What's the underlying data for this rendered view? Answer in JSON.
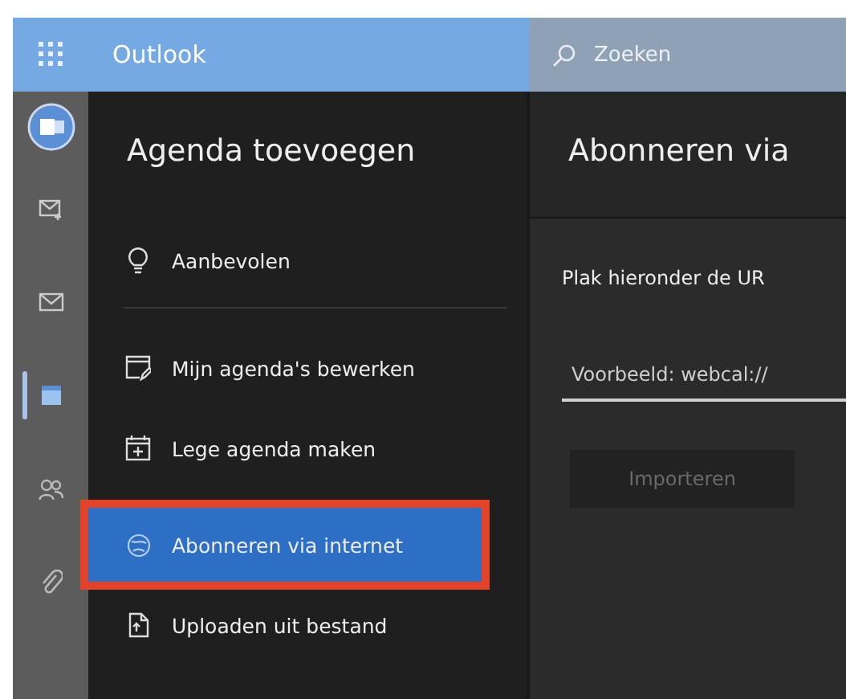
{
  "topbar": {
    "app_name": "Outlook",
    "search": {
      "placeholder": "Zoeken"
    }
  },
  "rail": [
    {
      "kind": "app",
      "selected": false
    },
    {
      "kind": "compose",
      "selected": false
    },
    {
      "kind": "mail",
      "selected": false
    },
    {
      "kind": "calendar",
      "selected": true
    },
    {
      "kind": "people",
      "selected": false
    },
    {
      "kind": "attach",
      "selected": false
    }
  ],
  "menu": {
    "title": "Agenda toevoegen",
    "items": [
      {
        "kind": "bulb",
        "label": "Aanbevolen",
        "selected": false,
        "highlighted": false,
        "divider_after": true
      },
      {
        "kind": "edit",
        "label": "Mijn agenda's bewerken",
        "selected": false,
        "highlighted": false,
        "divider_after": false
      },
      {
        "kind": "new",
        "label": "Lege agenda maken",
        "selected": false,
        "highlighted": false,
        "divider_after": false
      },
      {
        "kind": "globe",
        "label": "Abonneren via internet",
        "selected": true,
        "highlighted": true,
        "divider_after": false
      },
      {
        "kind": "file",
        "label": "Uploaden uit bestand",
        "selected": false,
        "highlighted": false,
        "divider_after": false
      }
    ]
  },
  "subscribe": {
    "title": "Abonneren via",
    "instruction": "Plak hieronder de UR",
    "url_field": {
      "placeholder": "Voorbeeld: webcal://"
    },
    "import_button": {
      "label": "Importeren",
      "disabled": true
    }
  }
}
